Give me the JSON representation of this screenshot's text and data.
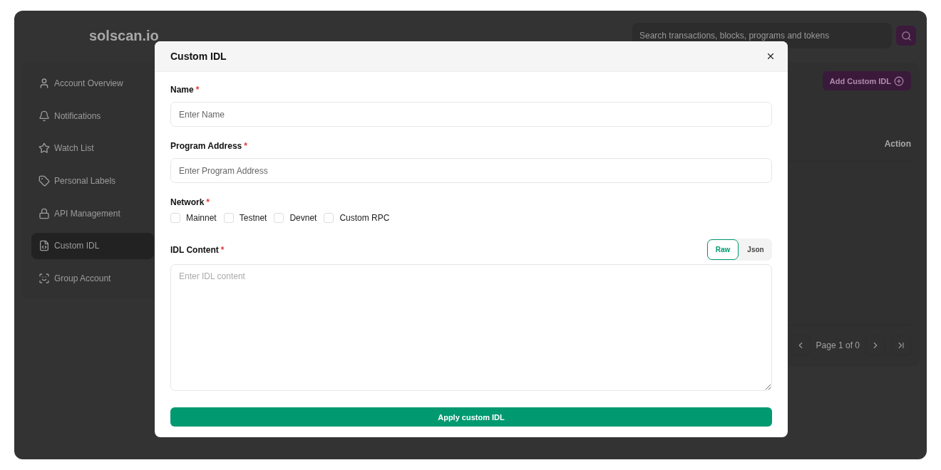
{
  "header": {
    "logo": "solscan.io",
    "search": {
      "placeholder": "Search transactions, blocks, programs and tokens"
    }
  },
  "sidebar": {
    "items": [
      {
        "label": "Account Overview",
        "selected": false
      },
      {
        "label": "Notifications",
        "selected": false
      },
      {
        "label": "Watch List",
        "selected": false
      },
      {
        "label": "Personal Labels",
        "selected": false
      },
      {
        "label": "API Management",
        "selected": false
      },
      {
        "label": "Custom IDL",
        "selected": true
      },
      {
        "label": "Group Account",
        "selected": false
      }
    ]
  },
  "main": {
    "add_button": "Add Custom IDL",
    "table": {
      "columns": [
        "Action"
      ]
    },
    "pagination": {
      "label": "Page 1 of 0"
    }
  },
  "modal": {
    "title": "Custom IDL",
    "fields": [
      {
        "label": "Name",
        "required_mark": "*",
        "placeholder": "Enter Name"
      },
      {
        "label": "Program Address",
        "required_mark": "*",
        "placeholder": "Enter Program Address"
      }
    ],
    "network": {
      "label": "Network",
      "required_mark": "*",
      "options": [
        {
          "label": "Mainnet",
          "checked": false
        },
        {
          "label": "Testnet",
          "checked": false
        },
        {
          "label": "Devnet",
          "checked": false
        },
        {
          "label": "Custom RPC",
          "checked": false
        }
      ]
    },
    "content": {
      "label": "IDL Content",
      "required_mark": "*",
      "placeholder": "Enter IDL content",
      "modes": [
        {
          "label": "Raw",
          "selected": true
        },
        {
          "label": "Json",
          "selected": false
        }
      ]
    },
    "submit": "Apply custom IDL"
  }
}
